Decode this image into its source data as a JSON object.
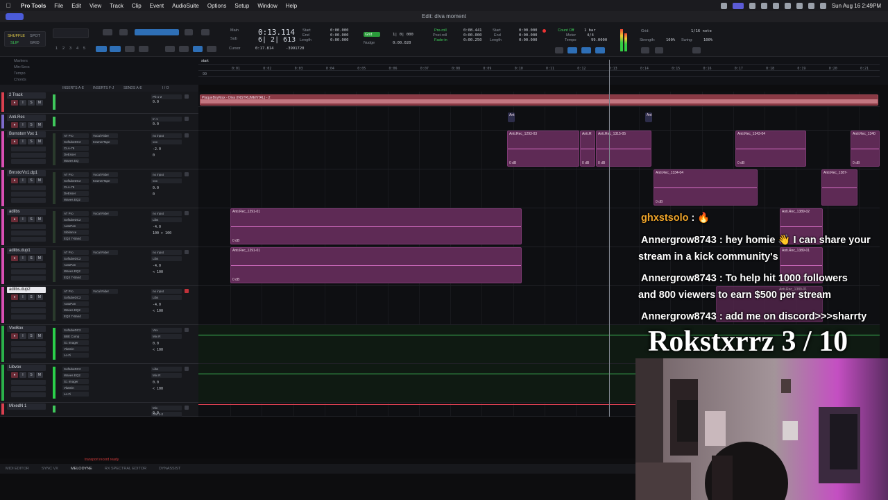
{
  "menubar": {
    "app": "Pro Tools",
    "items": [
      "File",
      "Edit",
      "View",
      "Track",
      "Clip",
      "Event",
      "AudioSuite",
      "Options",
      "Setup",
      "Window",
      "Help"
    ],
    "clock": "Sun Aug 16  2:49PM"
  },
  "window": {
    "title": "Edit: diva moment"
  },
  "toolbar": {
    "modes": [
      "SHUFFLE",
      "SPOT",
      "SLIP",
      "GRID"
    ],
    "zoom_presets": [
      "1",
      "2",
      "3",
      "4",
      "5"
    ],
    "counter_main_label": "Main",
    "counter_main": "0:13.114",
    "counter_sub_label": "Sub",
    "counter_sub": "6| 2| 613",
    "cursor_label": "Cursor",
    "cursor_value": "0:17.814",
    "cursor_sample": "-3991720",
    "start_label": "Start",
    "end_label": "End",
    "length_label": "Length",
    "start_value": "0:00.000",
    "end_value": "0:00.000",
    "length_value": "0:00.000",
    "grid_label": "Grid",
    "grid_value": "1| 0| 000",
    "nudge_label": "Nudge",
    "nudge_value": "0:00.020",
    "preroll_label": "Pre-roll",
    "postroll_label": "Post-roll",
    "fadein_label": "Fade-in",
    "preroll_value": "0:08.441",
    "postroll_value": "0:00.000",
    "fadein_value": "0:00.250",
    "t_start_value": "0:00.000",
    "t_end_value": "0:00.000",
    "t_length_value": "0:00.000",
    "countoff_label": "Count Off",
    "countoff_value": "1 bar",
    "meter_label": "Meter",
    "meter_value": "4/4",
    "tempo_label": "Tempo",
    "tempo_value": "99.0000",
    "grid2_label": "Grid:",
    "grid2_value": "1/16 note",
    "strength_label": "Strength:",
    "strength_value": "100%",
    "swing_label": "Swing:",
    "swing_value": "100%"
  },
  "rulers": [
    "Markers",
    "Min:Secs",
    "Tempo",
    "Chords"
  ],
  "timeline_ticks": [
    "0:01",
    "0:02",
    "0:03",
    "0:04",
    "0:05",
    "0:06",
    "0:07",
    "0:08",
    "0:09",
    "0:10",
    "0:11",
    "0:12",
    "0:13",
    "0:14",
    "0:15",
    "0:16",
    "0:17",
    "0:18",
    "0:19",
    "0:20",
    "0:21"
  ],
  "ruler_marker": "start",
  "ruler_tempo": "99",
  "track_columns": {
    "inserts_ae": "INSERTS A-E",
    "inserts_fj": "INSERTS F-J",
    "sends_ae": "SENDS A-E",
    "io": "I / O"
  },
  "tracks": [
    {
      "name": "2 Track",
      "color": "#d9404f",
      "inserts": [],
      "sends": [],
      "io": [
        "Pb 1-2"
      ],
      "vol": "0.0",
      "pan": "",
      "selected": false
    },
    {
      "name": "Anti.Rec",
      "color": "#7d6acb",
      "inserts": [],
      "sends": [],
      "io": [
        "In 1"
      ],
      "vol": "0.0",
      "pan": "",
      "selected": false
    },
    {
      "name": "Bornstxrr Vox 1",
      "color": "#d94fb3",
      "inserts": [
        "AT Pro",
        "SoftubeDC2",
        "CLA-76",
        "DeEsser",
        "Waves EQ"
      ],
      "sends": [
        "Vocal Rider",
        "KramerTape"
      ],
      "io": [
        "no input",
        "vox"
      ],
      "vol": "-2.0",
      "pan": "0",
      "selected": false
    },
    {
      "name": "BrnstxrVx1.dp1",
      "color": "#d94fb3",
      "inserts": [
        "AT Pro",
        "SoftubeDC2",
        "CLA-76",
        "DeEsser",
        "Waves EQ2"
      ],
      "sends": [
        "Vocal Rider",
        "KramerTape"
      ],
      "io": [
        "no input",
        "vox"
      ],
      "vol": "0.0",
      "pan": "0",
      "selected": false
    },
    {
      "name": "adlibs",
      "color": "#d94fb3",
      "inserts": [
        "AT Pro",
        "SoftubeDC2",
        "AutoPan",
        "Sibilance",
        "EQ3 7-Band"
      ],
      "sends": [
        "Vocal Rider"
      ],
      "io": [
        "no input",
        "Libs"
      ],
      "vol": "-4.0",
      "pan": "100 > 100",
      "selected": false
    },
    {
      "name": "adlibs.dup1",
      "color": "#d94fb3",
      "inserts": [
        "AT Pro",
        "SoftubeDC2",
        "AutoPan",
        "Waves EQ2",
        "EQ3 7-Band"
      ],
      "sends": [
        "Vocal Rider"
      ],
      "io": [
        "no input",
        "Libs"
      ],
      "vol": "-4.0",
      "pan": "< 100",
      "selected": false
    },
    {
      "name": "adlibs.dup2",
      "color": "#d94fb3",
      "inserts": [
        "AT Pro",
        "SoftubeDC2",
        "AutoPan",
        "Waves EQ2",
        "EQ3 7-Band"
      ],
      "sends": [
        "Vocal Rider"
      ],
      "io": [
        "no input",
        "Libs"
      ],
      "vol": "-4.0",
      "pan": "< 100",
      "selected": true
    },
    {
      "name": "VoxBox",
      "color": "#2bb14a",
      "inserts": [
        "SoftubeDC2",
        "BBE Comp",
        "S1 Imager",
        "Vitamin",
        "Lo-Fi"
      ],
      "sends": [],
      "io": [
        "Vox",
        "Mix R"
      ],
      "vol": "0.0",
      "pan": "< 100",
      "selected": false
    },
    {
      "name": "Libvox",
      "color": "#2bb14a",
      "inserts": [
        "SoftubeDC2",
        "Waves EQ2",
        "S1 Imager",
        "Vitamin",
        "Lo-Fi"
      ],
      "sends": [],
      "io": [
        "Libs",
        "Mix R"
      ],
      "vol": "0.0",
      "pan": "< 100",
      "selected": false
    },
    {
      "name": "MixedN 1",
      "color": "#d9404f",
      "inserts": [],
      "sends": [],
      "io": [
        "Mix",
        "Out 1-2"
      ],
      "vol": "0.0",
      "pan": "",
      "selected": false
    }
  ],
  "clips": {
    "track2": "PlaqueBoyMax - Diva (INSTRUMENTAL) - 2",
    "anti_a": "Ant",
    "anti_b": "Ant",
    "vox1_a": "Anti.Rec_1293-03",
    "vox1_b": "Anti.R",
    "vox1_c": "Anti.Rec_1315-05",
    "vox1_d": "Anti.Rec_1343-04",
    "vox1_e": "Anti.Rec_1340",
    "dp1_a": "Anti.Rec_1334-04",
    "dp1_b": "Anti.Rec_1387-",
    "adlibs_a": "Anti.Rec_1291-01",
    "adlibs_b": "Anti.Rec_1389-02",
    "dup1_a": "Anti.Rec_1291-01",
    "dup1_b": "Anti.Rec_1389-01",
    "dup2_a": "Anti.Rec_1389-01",
    "db": "0 dB"
  },
  "chat": [
    {
      "user": "ghxstsolo",
      "message": "🔥"
    },
    {
      "user": "Annergrow8743",
      "message": "hey homie 👋 I can share your",
      "cont": "stream in a kick community's"
    },
    {
      "user": "Annergrow8743",
      "message": "To help hit 1000 followers",
      "cont": "and 800 viewers to earn $500 per stream"
    },
    {
      "user": "Annergrow8743",
      "message": "add me on discord>>>sharrty"
    }
  ],
  "overlay_counter": "Rokstxrrz 3 / 10",
  "status_text": "transport record ready",
  "bottom_tabs": [
    "MIDI EDITOR",
    "SYNC VX",
    "MELODYNE",
    "RX SPECTRAL EDITOR",
    "DYNASSIST"
  ],
  "colors": {
    "accent": "#2e6fb6",
    "clip_purple": "#5e2a55",
    "clip_red": "#8a3a45",
    "record": "#e33333",
    "play": "#37c24a"
  }
}
